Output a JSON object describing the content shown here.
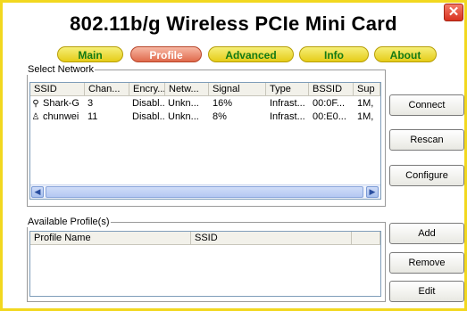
{
  "title": "802.11b/g Wireless PCIe Mini Card",
  "close_glyph": "✕",
  "tabs": [
    {
      "label": "Main",
      "active": false
    },
    {
      "label": "Profile",
      "active": true
    },
    {
      "label": "Advanced",
      "active": false
    },
    {
      "label": "Info",
      "active": false
    },
    {
      "label": "About",
      "active": false
    }
  ],
  "select_network": {
    "legend": "Select Network",
    "columns": [
      "SSID",
      "Chan...",
      "Encry...",
      "Netw...",
      "Signal",
      "Type",
      "BSSID",
      "Sup"
    ],
    "rows": [
      {
        "icon": "access-point-icon",
        "icon_glyph": "⚲",
        "cells": [
          "Shark-G",
          "3",
          "Disabl...",
          "Unkn...",
          "16%",
          "Infrast...",
          "00:0F...",
          "1M,"
        ]
      },
      {
        "icon": "adhoc-user-icon",
        "icon_glyph": "♙",
        "cells": [
          "chunwei",
          "11",
          "Disabl...",
          "Unkn...",
          "8%",
          "Infrast...",
          "00:E0...",
          "1M,"
        ]
      }
    ]
  },
  "available_profiles": {
    "legend": "Available Profile(s)",
    "columns": [
      "Profile Name",
      "SSID",
      ""
    ]
  },
  "buttons": {
    "connect": "Connect",
    "rescan": "Rescan",
    "configure": "Configure",
    "add": "Add",
    "remove": "Remove",
    "edit": "Edit"
  },
  "scroll": {
    "left_glyph": "◀",
    "right_glyph": "▶"
  }
}
